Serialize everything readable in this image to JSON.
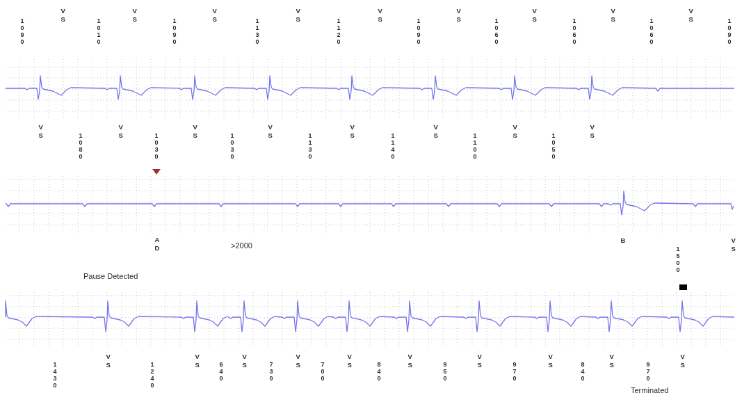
{
  "rows": [
    {
      "kind": "labels",
      "items": [
        {
          "kind": "interval",
          "text": "1090"
        },
        {
          "kind": "marker",
          "text": "VS"
        },
        {
          "kind": "interval",
          "text": "1010"
        },
        {
          "kind": "marker",
          "text": "VS"
        },
        {
          "kind": "interval",
          "text": "1090"
        },
        {
          "kind": "marker",
          "text": "VS"
        },
        {
          "kind": "interval",
          "text": "1130"
        },
        {
          "kind": "marker",
          "text": "VS"
        },
        {
          "kind": "interval",
          "text": "1120"
        },
        {
          "kind": "marker",
          "text": "VS"
        },
        {
          "kind": "interval",
          "text": "1090"
        },
        {
          "kind": "marker",
          "text": "VS"
        },
        {
          "kind": "interval",
          "text": "1060"
        },
        {
          "kind": "marker",
          "text": "VS"
        },
        {
          "kind": "interval",
          "text": "1060"
        },
        {
          "kind": "marker",
          "text": "VS"
        },
        {
          "kind": "interval",
          "text": "1060"
        },
        {
          "kind": "marker",
          "text": "VS"
        },
        {
          "kind": "interval",
          "text": "1090"
        }
      ]
    },
    {
      "kind": "trace"
    },
    {
      "kind": "labels",
      "items": [
        {
          "kind": "marker",
          "text": "VS"
        },
        {
          "kind": "interval",
          "text": "1080"
        },
        {
          "kind": "marker",
          "text": "VS"
        },
        {
          "kind": "interval",
          "text": "1030"
        },
        {
          "kind": "marker",
          "text": "VS"
        },
        {
          "kind": "interval",
          "text": "1030"
        },
        {
          "kind": "marker",
          "text": "VS"
        },
        {
          "kind": "interval",
          "text": "1130"
        },
        {
          "kind": "marker",
          "text": "VS"
        },
        {
          "kind": "interval",
          "text": "1140"
        },
        {
          "kind": "marker",
          "text": "VS"
        },
        {
          "kind": "interval",
          "text": "1100"
        },
        {
          "kind": "marker",
          "text": "VS"
        },
        {
          "kind": "interval",
          "text": "1050"
        },
        {
          "kind": "marker",
          "text": "VS"
        }
      ]
    },
    {
      "kind": "trace"
    },
    {
      "kind": "labels",
      "items": [
        {
          "kind": "marker",
          "text": "AD"
        },
        {
          "kind": "note",
          "text": ">2000"
        },
        {
          "kind": "marker",
          "text": "B"
        },
        {
          "kind": "marker",
          "text": "VS"
        },
        {
          "kind": "interval",
          "text": "1500"
        },
        {
          "kind": "note",
          "text": "Pause Detected"
        }
      ]
    },
    {
      "kind": "trace"
    },
    {
      "kind": "labels",
      "items": [
        {
          "kind": "interval",
          "text": "1430"
        },
        {
          "kind": "marker",
          "text": "VS"
        },
        {
          "kind": "interval",
          "text": "1240"
        },
        {
          "kind": "marker",
          "text": "VS"
        },
        {
          "kind": "interval",
          "text": "640"
        },
        {
          "kind": "marker",
          "text": "VS"
        },
        {
          "kind": "interval",
          "text": "730"
        },
        {
          "kind": "marker",
          "text": "VS"
        },
        {
          "kind": "interval",
          "text": "700"
        },
        {
          "kind": "marker",
          "text": "VS"
        },
        {
          "kind": "interval",
          "text": "840"
        },
        {
          "kind": "marker",
          "text": "VS"
        },
        {
          "kind": "interval",
          "text": "950"
        },
        {
          "kind": "marker",
          "text": "VS"
        },
        {
          "kind": "interval",
          "text": "970"
        },
        {
          "kind": "marker",
          "text": "VS"
        },
        {
          "kind": "interval",
          "text": "840"
        },
        {
          "kind": "marker",
          "text": "VS"
        },
        {
          "kind": "interval",
          "text": "970"
        },
        {
          "kind": "marker",
          "text": "VS"
        },
        {
          "kind": "note",
          "text": "Terminated"
        }
      ]
    }
  ]
}
